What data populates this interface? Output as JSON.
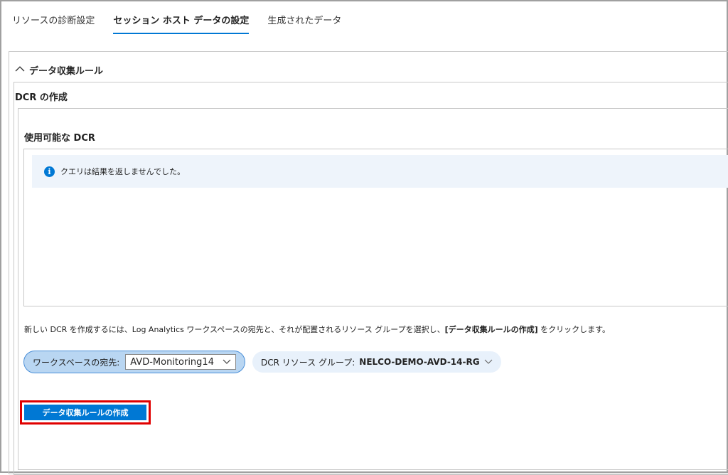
{
  "tabs": [
    {
      "label": "リソースの診断設定"
    },
    {
      "label": "セッション ホスト データの設定",
      "active": true
    },
    {
      "label": "生成されたデータ"
    }
  ],
  "section": {
    "title": "データ収集ルール",
    "expanded": true
  },
  "dcr": {
    "title": "DCR の作成",
    "available_title": "使用可能な DCR",
    "info_message": "クエリは結果を返しませんでした。",
    "description_prefix": "新しい DCR を作成するには、Log Analytics ワークスペースの宛先と、それが配置されるリソース グループを選択し、",
    "description_bold": "[データ収集ルールの作成]",
    "description_suffix": " をクリックします。",
    "workspace_label": "ワークスペースの宛先:",
    "workspace_value": "AVD-Monitoring14",
    "rg_label": "DCR リソース グループ:",
    "rg_value": "NELCO-DEMO-AVD-14-RG",
    "create_button": "データ収集ルールの作成"
  },
  "colors": {
    "accent": "#0078d4",
    "highlight": "#e00000"
  }
}
